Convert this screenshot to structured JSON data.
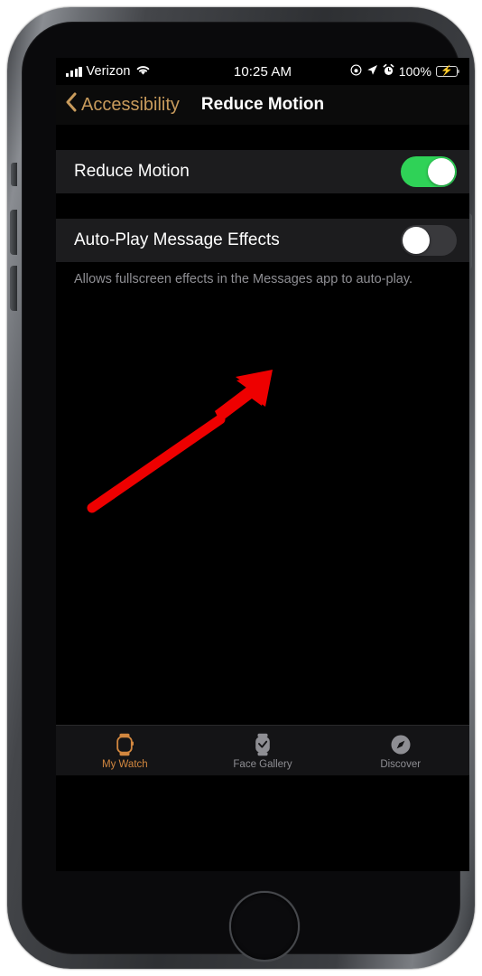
{
  "device": {
    "frame_name": "iphone-home-button",
    "camera_icon": "front-camera-icon",
    "speaker_icon": "earpiece-speaker-icon",
    "home_button": "home-button"
  },
  "status_bar": {
    "signal_icon": "cellular-signal-icon",
    "carrier": "Verizon",
    "wifi_icon": "wifi-icon",
    "time": "10:25 AM",
    "dnd_icon": "do-not-disturb-icon",
    "location_icon": "location-arrow-icon",
    "alarm_icon": "alarm-clock-icon",
    "battery_percent": "100%",
    "battery_icon": "battery-charging-icon",
    "battery_color": "#34c759"
  },
  "nav_bar": {
    "back_chevron_icon": "chevron-left-icon",
    "back_label": "Accessibility",
    "title": "Reduce Motion",
    "accent_color": "#c89b5c"
  },
  "settings": {
    "rows": [
      {
        "label": "Reduce Motion",
        "toggle_state": "on",
        "toggle_color": "#2fd257"
      },
      {
        "label": "Auto-Play Message Effects",
        "toggle_state": "off",
        "toggle_color": "#39393c"
      }
    ],
    "footer_note": "Allows fullscreen effects in the Messages app to auto-play."
  },
  "annotation": {
    "arrow_icon": "red-arrow-annotation",
    "color": "#ee0000",
    "points_to": "Auto-Play Message Effects toggle"
  },
  "tab_bar": {
    "items": [
      {
        "label": "My Watch",
        "icon": "apple-watch-icon",
        "active": true
      },
      {
        "label": "Face Gallery",
        "icon": "watch-face-icon",
        "active": false
      },
      {
        "label": "Discover",
        "icon": "compass-icon",
        "active": false
      }
    ],
    "active_color": "#d2873f",
    "inactive_color": "#8e8e93"
  }
}
